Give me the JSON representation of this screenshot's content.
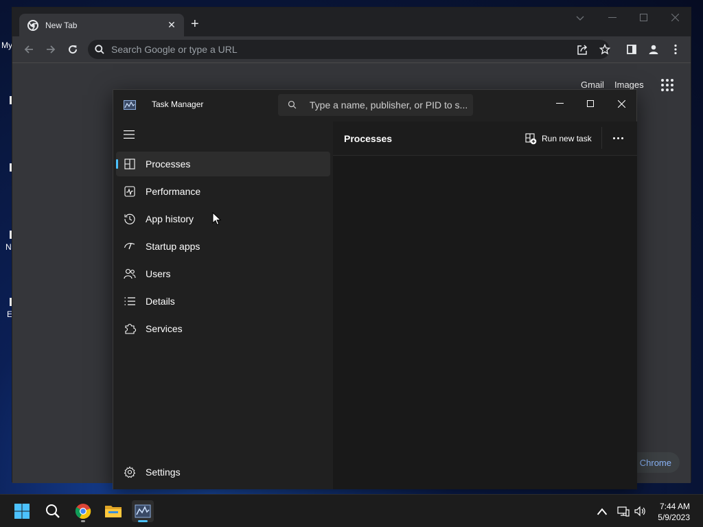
{
  "desktop": {
    "fragments": [
      "My",
      "N",
      "E"
    ]
  },
  "chrome": {
    "tab_title": "New Tab",
    "new_tab_symbol": "+",
    "omnibox_placeholder": "Search Google or type a URL",
    "gmail": "Gmail",
    "images": "Images",
    "customize_label": "Chrome"
  },
  "task_manager": {
    "title": "Task Manager",
    "search_placeholder": "Type a name, publisher, or PID to s...",
    "nav": [
      {
        "label": "Processes",
        "icon": "processes-icon",
        "active": true
      },
      {
        "label": "Performance",
        "icon": "performance-icon"
      },
      {
        "label": "App history",
        "icon": "app-history-icon"
      },
      {
        "label": "Startup apps",
        "icon": "startup-apps-icon"
      },
      {
        "label": "Users",
        "icon": "users-icon"
      },
      {
        "label": "Details",
        "icon": "details-icon"
      },
      {
        "label": "Services",
        "icon": "services-icon"
      }
    ],
    "settings_label": "Settings",
    "main_title": "Processes",
    "run_new_task": "Run new task",
    "accent": "#4cc2ff"
  },
  "taskbar": {
    "time": "7:44 AM",
    "date": "5/9/2023",
    "apps": [
      "start-icon",
      "search-icon",
      "chrome-icon",
      "file-explorer-icon",
      "task-manager-icon"
    ]
  }
}
